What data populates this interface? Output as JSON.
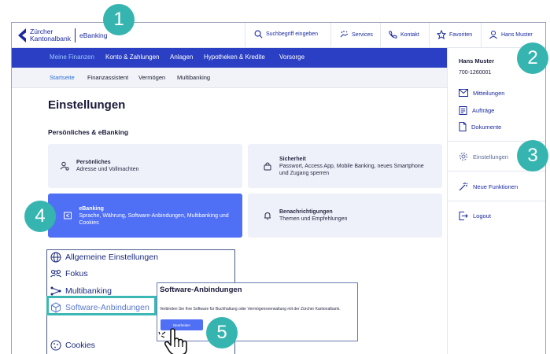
{
  "header": {
    "brand_line1": "Zürcher",
    "brand_line2": "Kantonalbank",
    "product": "eBanking",
    "search_placeholder": "Suchbegriff eingeben",
    "services": "Services",
    "kontakt": "Kontakt",
    "favoriten": "Favoriten",
    "user": "Hans Muster"
  },
  "nav": {
    "items": [
      "Meine Finanzen",
      "Konto & Zahlungen",
      "Anlagen",
      "Hypotheken & Kredite",
      "Vorsorge"
    ]
  },
  "subnav": {
    "items": [
      "Startseite",
      "Finanzassistent",
      "Vermögen",
      "Multibanking"
    ]
  },
  "main": {
    "title": "Einstellungen",
    "section": "Persönliches & eBanking",
    "cards": [
      {
        "title": "Persönliches",
        "desc": "Adresse und Vollmachten"
      },
      {
        "title": "Sicherheit",
        "desc": "Passwort, Access App, Mobile Banking, neues Smartphone und Zugang sperren"
      },
      {
        "title": "eBanking",
        "desc": "Sprache, Währung, Software-Anbindungen, Multibanking und Cookies"
      },
      {
        "title": "Benachrichtigungen",
        "desc": "Themen und Empfehlungen"
      }
    ]
  },
  "sidebar": {
    "name": "Hans Muster",
    "number": "700-1260001",
    "items": [
      "Mitteilungen",
      "Aufträge",
      "Dokumente",
      "Einstellungen",
      "Neue Funktionen",
      "Logout"
    ]
  },
  "menu": {
    "items": [
      "Allgemeine Einstellungen",
      "Fokus",
      "Multibanking",
      "Software-Anbindungen",
      "Cookies"
    ]
  },
  "popover": {
    "title": "Software-Anbindungen",
    "text": "Verbinden Sie Ihre Software für Buchhaltung oder Vermögensverwaltung mit der Zürcher Kantonalbank.",
    "button": "Bearbeiten"
  },
  "badges": [
    "1",
    "2",
    "3",
    "4",
    "5"
  ],
  "colors": {
    "nav_blue": "#2b3fc4",
    "accent_blue": "#4f6ff5",
    "badge_teal": "#36b5b0"
  }
}
